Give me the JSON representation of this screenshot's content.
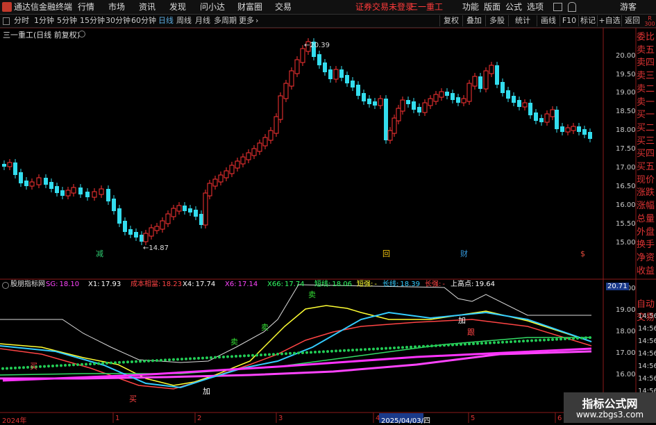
{
  "titlebar": {
    "app_name": "通达信金融终端",
    "menus": [
      "行情",
      "市场",
      "资讯",
      "发现",
      "问小达",
      "财富圈",
      "交易"
    ],
    "login_notice": "证券交易未登录",
    "stock_name": "三一重工",
    "right_menus": [
      "功能",
      "版面",
      "公式",
      "选项"
    ],
    "user": "游客",
    "colors": {
      "accent": "#ff3b3b",
      "bg": "#111111"
    }
  },
  "periodbar": {
    "items": [
      "分时",
      "1分钟",
      "5分钟",
      "15分钟",
      "30分钟",
      "60分钟",
      "日线",
      "周线",
      "月线",
      "多周期",
      "更多"
    ],
    "active": "日线",
    "right_buttons": [
      "复权",
      "叠加",
      "多股",
      "统计",
      "画线",
      "F10",
      "标记",
      "+自选",
      "返回"
    ]
  },
  "main_chart": {
    "title": "三一重工(日线 前复权)",
    "high_label": "20.39",
    "low_label": "14.87",
    "y_ticks": [
      "20.00",
      "19.50",
      "19.00",
      "18.50",
      "18.00",
      "17.50",
      "17.00",
      "16.50",
      "16.00",
      "15.50",
      "15.00"
    ],
    "markers": [
      {
        "text": "减",
        "color": "#2ecc71"
      },
      {
        "text": "回",
        "color": "#f1c40f"
      },
      {
        "text": "财",
        "color": "#3498db"
      },
      {
        "text": "$",
        "color": "#e74c3c"
      }
    ],
    "top_right_badge": [
      "R",
      "300"
    ]
  },
  "side_panel": {
    "items": [
      "委比",
      "卖五",
      "卖四",
      "卖三",
      "卖二",
      "卖一",
      "买一",
      "买二",
      "买三",
      "买四",
      "买五",
      "现价",
      "涨跌",
      "涨幅",
      "总量",
      "外盘",
      "换手",
      "净资",
      "收益",
      "自动",
      "交易"
    ],
    "times": [
      "14:56",
      "14:56",
      "14:56",
      "14:56",
      "14:56",
      "14:56",
      "14:56",
      "14:56"
    ],
    "value_tag": "20.71"
  },
  "indicator": {
    "name": "股朋指标网",
    "params": [
      {
        "label": "SG:",
        "value": "18.10",
        "color": "#ff44ff"
      },
      {
        "label": "X1:",
        "value": "17.93",
        "color": "#ffffff"
      },
      {
        "label": "成本相當:",
        "value": "18.23",
        "color": "#ff4444"
      },
      {
        "label": "X4:",
        "value": "17.74",
        "color": "#ffffff"
      },
      {
        "label": "X6:",
        "value": "17.14",
        "color": "#ff44ff"
      },
      {
        "label": "X66:",
        "value": "17.74",
        "color": "#33ff66"
      },
      {
        "label": "短线:",
        "value": "18.06",
        "color": "#33ff66"
      },
      {
        "label": "短强:",
        "value": "-",
        "color": "#ffff33"
      },
      {
        "label": "长线:",
        "value": "18.39",
        "color": "#33ccff"
      },
      {
        "label": "长强:",
        "value": "-",
        "color": "#ff4444"
      },
      {
        "label": "上高点:",
        "value": "19.64",
        "color": "#ffffff"
      }
    ],
    "y_ticks": [
      "20.00",
      "19.00",
      "18.00",
      "17.00",
      "16.00"
    ],
    "labels": [
      {
        "text": "卖",
        "color": "#33dd33"
      },
      {
        "text": "卖",
        "color": "#33dd33"
      },
      {
        "text": "卖",
        "color": "#33dd33"
      },
      {
        "text": "买",
        "color": "#ff4444"
      },
      {
        "text": "加",
        "color": "#ffffff"
      },
      {
        "text": "加",
        "color": "#ffffff"
      },
      {
        "text": "跟",
        "color": "#ff4444"
      },
      {
        "text": "买",
        "color": "#ff4444"
      }
    ]
  },
  "xaxis": {
    "labels": [
      "2024年",
      "1",
      "2",
      "3",
      "4",
      "2025/04/03/四",
      "5",
      "6"
    ]
  },
  "watermark": {
    "line1": "指标公式网",
    "line2": "www.zbgs3.com"
  }
}
